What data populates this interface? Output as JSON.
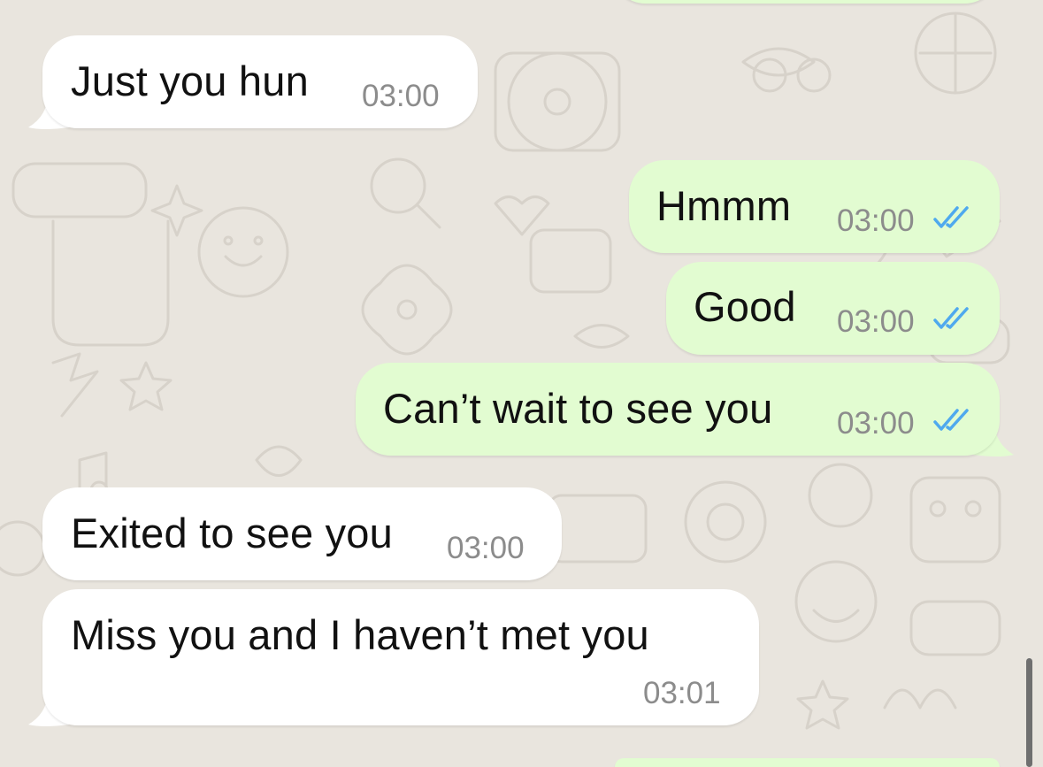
{
  "messages": [
    {
      "direction": "incoming",
      "text": "Just you hun",
      "time": "03:00"
    },
    {
      "direction": "outgoing",
      "text": "Hmmm",
      "time": "03:00",
      "status": "read",
      "status_icon": "double-check-icon"
    },
    {
      "direction": "outgoing",
      "text": "Good",
      "time": "03:00",
      "status": "read",
      "status_icon": "double-check-icon"
    },
    {
      "direction": "outgoing",
      "text": "Can’t wait to see you",
      "time": "03:00",
      "status": "read",
      "status_icon": "double-check-icon"
    },
    {
      "direction": "incoming",
      "text": "Exited to see you",
      "time": "03:00"
    },
    {
      "direction": "incoming",
      "text": "Miss you and I haven’t met you",
      "time": "03:01"
    }
  ],
  "colors": {
    "background": "#e9e5de",
    "incoming_bubble": "#ffffff",
    "outgoing_bubble": "#e2fcd1",
    "read_tick": "#4fa9ee",
    "timestamp": "#8c8c8c"
  }
}
